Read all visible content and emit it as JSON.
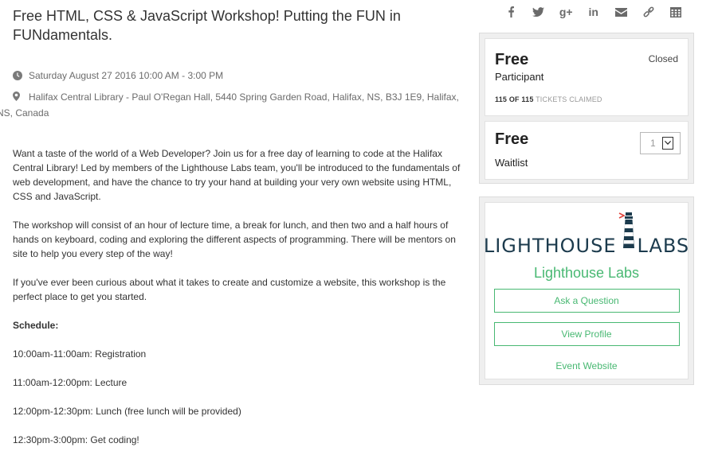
{
  "event": {
    "title": "Free HTML, CSS & JavaScript Workshop! Putting the FUN in FUNdamentals.",
    "datetime": "Saturday August 27 2016 10:00 AM - 3:00 PM",
    "location": "Halifax Central Library - Paul O'Regan Hall, 5440 Spring Garden Road, Halifax, NS, B3J 1E9, Halifax, NS, Canada"
  },
  "description": {
    "paragraphs": [
      "Want a taste of the world of a Web Developer? Join us for a free day of learning to code at the Halifax Central Library! Led by members of the Lighthouse Labs team, you'll be introduced to the fundamentals of web development, and have the chance to try your hand at building your very own website using HTML, CSS and JavaScript.",
      "The workshop will consist of an hour of lecture time, a break for lunch, and then two and a half hours of hands on keyboard, coding and exploring the different aspects of programming. There will be mentors on site to help you every step of the way!",
      "If you've ever been curious about what it takes to create and customize a website, this workshop is the perfect place to get you started."
    ],
    "schedule_heading": "Schedule:",
    "schedule": [
      "10:00am-11:00am: Registration",
      "11:00am-12:00pm: Lecture",
      "12:00pm-12:30pm: Lunch (free lunch will be provided)",
      "12:30pm-3:00pm: Get coding!"
    ]
  },
  "share": {
    "icons": [
      "facebook-icon",
      "twitter-icon",
      "google-plus-icon",
      "linkedin-icon",
      "email-icon",
      "link-icon",
      "calendar-icon"
    ],
    "gplus_glyph": "g+",
    "linkedin_glyph": "in"
  },
  "tickets": [
    {
      "price": "Free",
      "name": "Participant",
      "status": "Closed",
      "claimed_count": "115 OF 115",
      "claimed_label": "TICKETS CLAIMED"
    },
    {
      "price": "Free",
      "name": "Waitlist",
      "quantity": "1"
    }
  ],
  "organizer": {
    "logo_left": "LIGHTHOUSE",
    "logo_right": "LABS",
    "name": "Lighthouse Labs",
    "ask_button": "Ask a Question",
    "profile_button": "View Profile",
    "website_link": "Event Website"
  },
  "colors": {
    "accent_green": "#48b872",
    "logo_navy": "#1c3b4d",
    "logo_red": "#e0443c"
  }
}
